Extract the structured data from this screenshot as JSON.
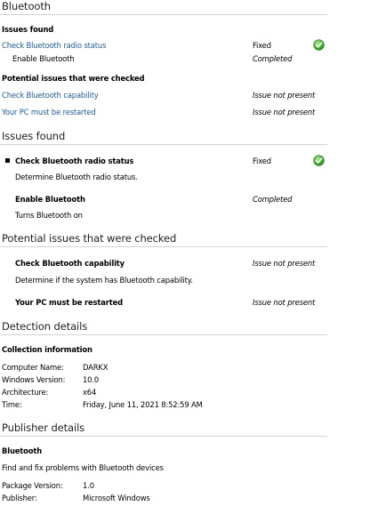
{
  "summary": {
    "title": "Bluetooth",
    "issues_found_heading": "Issues found",
    "issues": [
      {
        "name": "Check Bluetooth radio status",
        "status": "Fixed"
      },
      {
        "name": "Enable Bluetooth",
        "status": "Completed"
      }
    ],
    "potential_heading": "Potential issues that were checked",
    "potential": [
      {
        "name": "Check Bluetooth capability",
        "status": "Issue not present"
      },
      {
        "name": "Your PC must be restarted",
        "status": "Issue not present"
      }
    ]
  },
  "issues_found": {
    "title": "Issues found",
    "items": [
      {
        "name": "Check Bluetooth radio status",
        "status": "Fixed",
        "description": "Determine Bluetooth radio status."
      },
      {
        "name": "Enable Bluetooth",
        "status": "Completed",
        "description": "Turns Bluetooth on"
      }
    ]
  },
  "potential_issues": {
    "title": "Potential issues that were checked",
    "items": [
      {
        "name": "Check Bluetooth capability",
        "status": "Issue not present",
        "description": "Determine if the system has Bluetooth capability."
      },
      {
        "name": "Your PC must be restarted",
        "status": "Issue not present"
      }
    ]
  },
  "detection": {
    "title": "Detection details",
    "subtitle": "Collection information",
    "rows": [
      {
        "label": "Computer Name:",
        "value": "DARKX"
      },
      {
        "label": "Windows Version:",
        "value": "10.0"
      },
      {
        "label": "Architecture:",
        "value": "x64"
      },
      {
        "label": "Time:",
        "value": "Friday, June 11, 2021 8:52:59 AM"
      }
    ]
  },
  "publisher": {
    "title": "Publisher details",
    "name": "Bluetooth",
    "description": "Find and fix problems with Bluetooth devices",
    "rows": [
      {
        "label": "Package Version:",
        "value": "1.0"
      },
      {
        "label": "Publisher:",
        "value": "Microsoft Windows"
      }
    ]
  },
  "colors": {
    "link": "#1a5ca8",
    "check_green": "#3aa93a",
    "rule": "#d2d2d2"
  }
}
